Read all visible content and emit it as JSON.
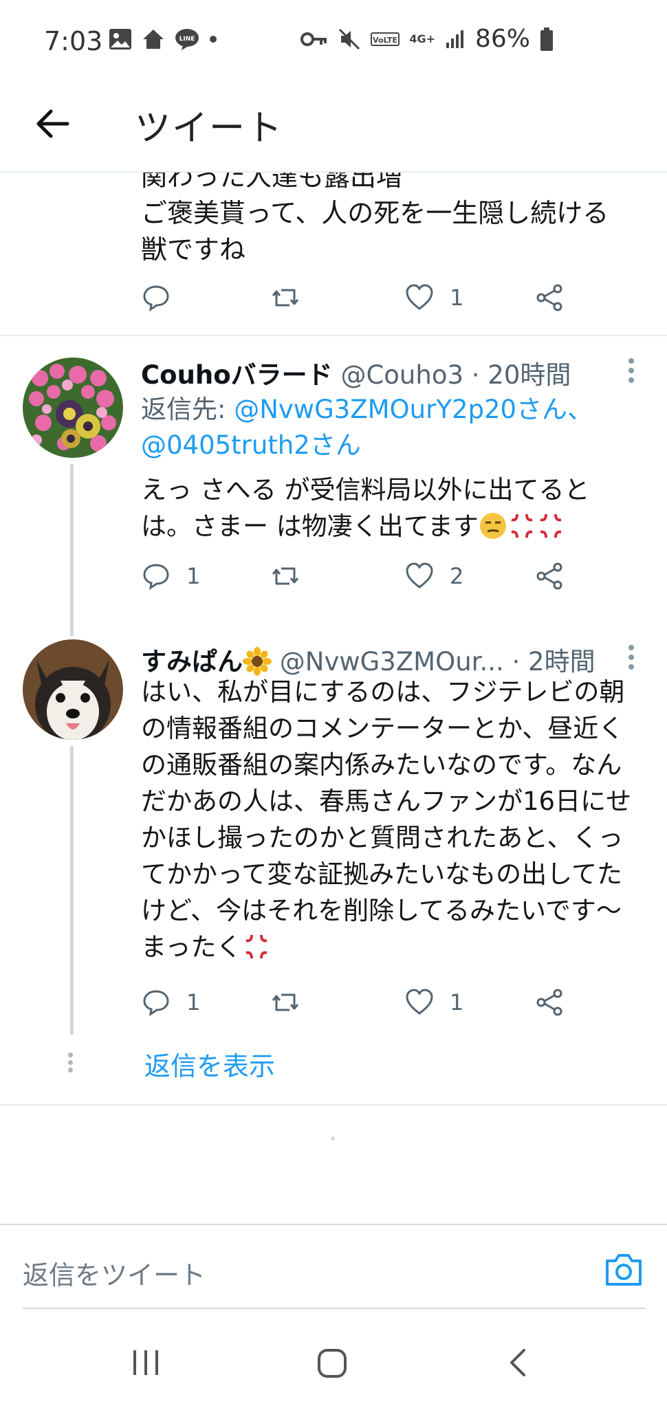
{
  "status_bar": {
    "time": "7:03",
    "battery": "86%",
    "network": "4G+"
  },
  "header": {
    "title": "ツイート"
  },
  "prev_tweet": {
    "text_line1": "関わった人達も露出増",
    "text_line2": "ご褒美貰って、人の死を一生隠し続ける",
    "text_line3": "獣ですね",
    "likes": "1"
  },
  "tweets": [
    {
      "name": "Couhoバラード",
      "handle": "@Couho3",
      "time": "· 20時間",
      "reply_to_label": "返信先: ",
      "reply_to_1": "@NvwG3ZMOurY2p20さん、",
      "reply_to_2": "@0405truth2さん",
      "body_line1": "えっ  さへる が受信料局以外に出てると",
      "body_line2": "は。さまー  は物凄く出てます",
      "replies": "1",
      "likes": "2"
    },
    {
      "name": "すみぱん",
      "handle": "@NvwG3ZMOur...",
      "time": "· 2時間",
      "body": "はい、私が目にするのは、フジテレビの朝の情報番組のコメンテーターとか、昼近くの通販番組の案内係みたいなのです。なんだかあの人は、春馬さんファンが16日にせかほし撮ったのかと質問されたあと、くってかかって変な証拠みたいなもの出してたけど、今はそれを削除してるみたいです～まったく",
      "replies": "1",
      "likes": "1"
    }
  ],
  "show_replies": "返信を表示",
  "composer": {
    "placeholder": "返信をツイート"
  },
  "colors": {
    "accent": "#1d9bf0",
    "secondary_text": "#536471",
    "divider": "#e6ecf0"
  }
}
